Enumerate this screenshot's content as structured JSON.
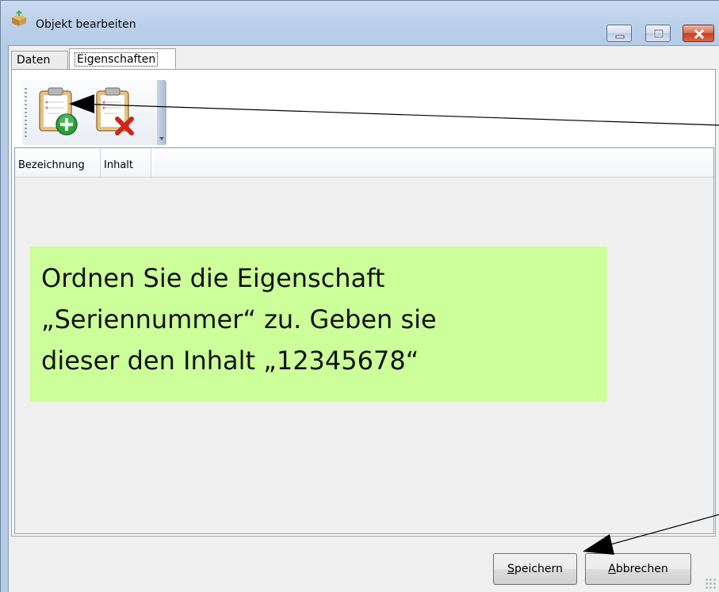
{
  "window": {
    "title": "Objekt bearbeiten",
    "controls": [
      "minimize-icon",
      "maximize-icon",
      "close-icon"
    ]
  },
  "tabs": [
    {
      "label": "Daten",
      "selected": false
    },
    {
      "label": "Eigenschaften",
      "selected": true
    }
  ],
  "toolbar": {
    "buttons": [
      {
        "icon": "clipboard-add-icon"
      },
      {
        "icon": "clipboard-delete-icon"
      }
    ]
  },
  "grid": {
    "columns": [
      "Bezeichnung",
      "Inhalt"
    ],
    "rows": []
  },
  "annotation": {
    "text": "Ordnen Sie die Eigenschaft\n„Seriennummer“ zu. Geben sie\ndieser den Inhalt „12345678“",
    "background": "#ccff99"
  },
  "footer": {
    "save_label_accel": "S",
    "save_label_rest": "peichern",
    "cancel_label_accel": "A",
    "cancel_label_rest": "bbrechen"
  }
}
